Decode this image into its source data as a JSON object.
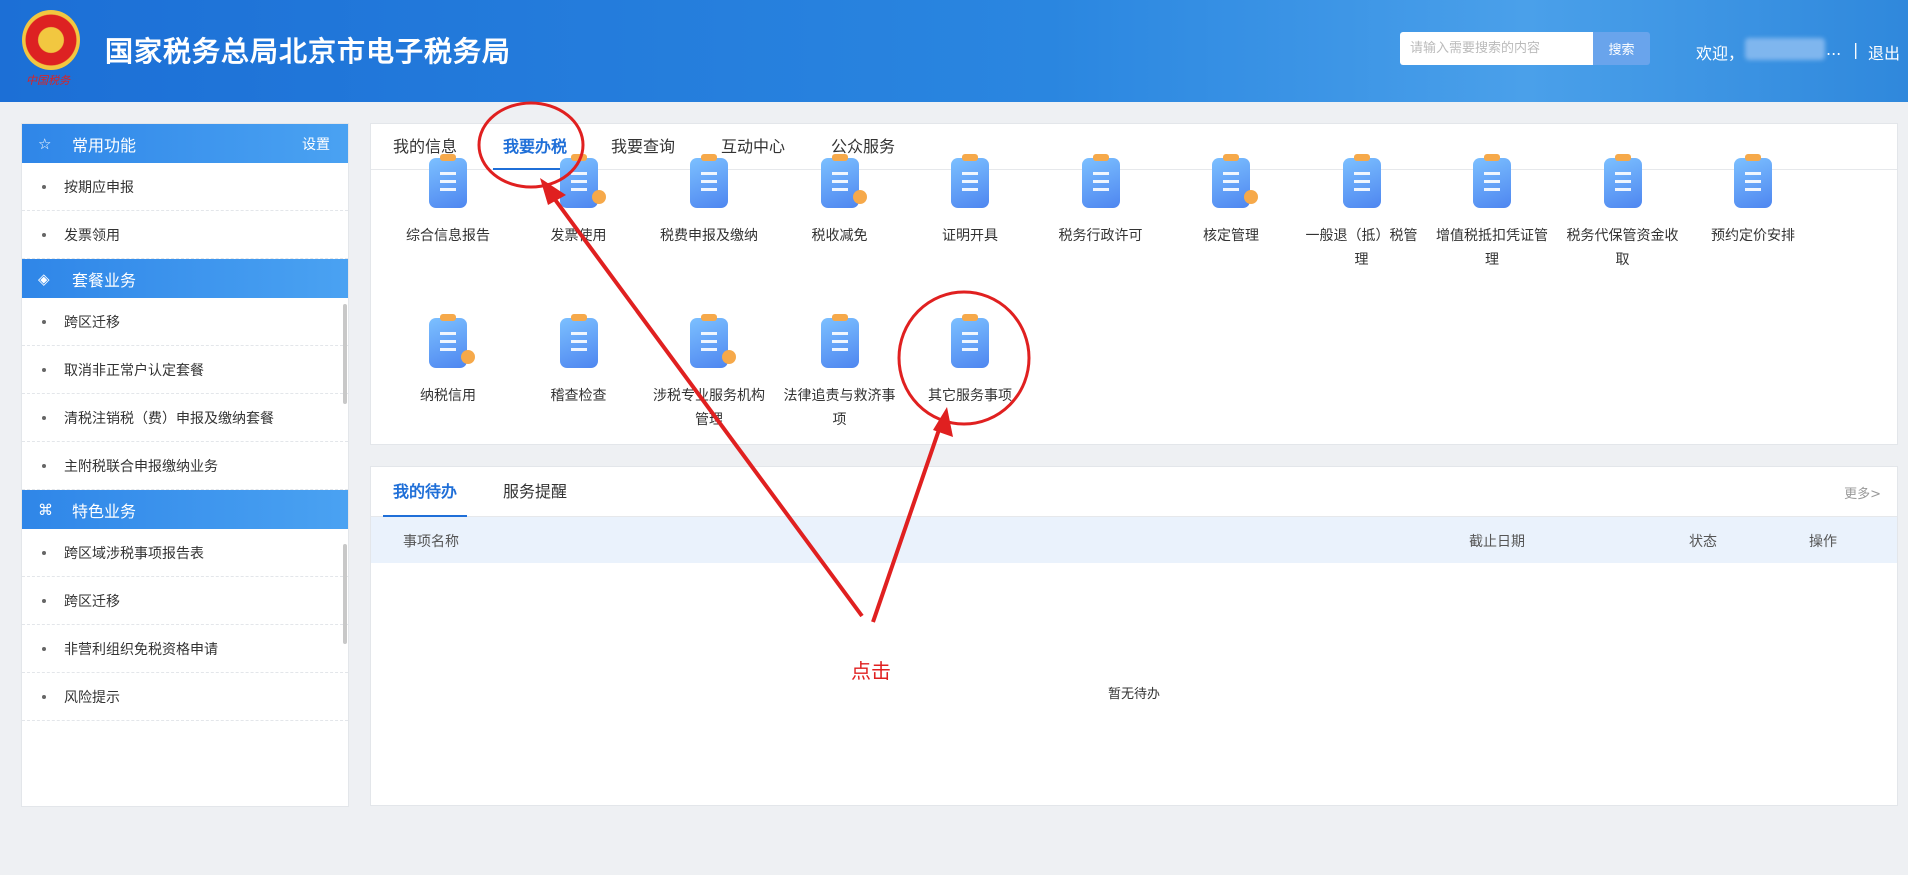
{
  "header": {
    "title": "国家税务总局北京市电子税务局",
    "emblem_text": "中国税务",
    "search_placeholder": "请输入需要搜索的内容",
    "search_label": "搜索",
    "welcome": "欢迎，",
    "welcome_suffix": "...",
    "separator": "|",
    "logout": "退出"
  },
  "sidebar": {
    "sections": [
      {
        "title": "常用功能",
        "icon": "star-icon",
        "action": "设置",
        "items": [
          "按期应申报",
          "发票领用"
        ]
      },
      {
        "title": "套餐业务",
        "icon": "layers-icon",
        "items": [
          "跨区迁移",
          "取消非正常户认定套餐",
          "清税注销税（费）申报及缴纳套餐",
          "主附税联合申报缴纳业务"
        ]
      },
      {
        "title": "特色业务",
        "icon": "grid-icon",
        "items": [
          "跨区域涉税事项报告表",
          "跨区迁移",
          "非营利组织免税资格申请",
          "风险提示"
        ]
      }
    ]
  },
  "main_tabs": [
    "我的信息",
    "我要办税",
    "我要查询",
    "互动中心",
    "公众服务"
  ],
  "services": [
    {
      "label": "综合信息报告",
      "icon": "clipboard-icon"
    },
    {
      "label": "发票使用",
      "icon": "invoice-check-icon"
    },
    {
      "label": "税费申报及缴纳",
      "icon": "wallet-yuan-icon"
    },
    {
      "label": "税收减免",
      "icon": "tax-coin-icon"
    },
    {
      "label": "证明开具",
      "icon": "ticket-yuan-icon"
    },
    {
      "label": "税务行政许可",
      "icon": "id-card-icon"
    },
    {
      "label": "核定管理",
      "icon": "user-gear-icon"
    },
    {
      "label": "一般退（抵）税管理",
      "icon": "refund-yuan-icon"
    },
    {
      "label": "增值税抵扣凭证管理",
      "icon": "vat-voucher-icon"
    },
    {
      "label": "税务代保管资金收取",
      "icon": "money-bag-hand-icon"
    },
    {
      "label": "预约定价安排",
      "icon": "compass-icon"
    },
    {
      "label": "纳税信用",
      "icon": "diamond-check-icon"
    },
    {
      "label": "稽查检查",
      "icon": "stamp-icon"
    },
    {
      "label": "涉税专业服务机构管理",
      "icon": "agent-gear-icon"
    },
    {
      "label": "法律追责与救济事项",
      "icon": "gavel-icon"
    },
    {
      "label": "其它服务事项",
      "icon": "clipboard-icon"
    }
  ],
  "todo": {
    "tabs": [
      "我的待办",
      "服务提醒"
    ],
    "more": "更多>",
    "columns": [
      "事项名称",
      "截止日期",
      "状态",
      "操作"
    ],
    "empty": "暂无待办"
  },
  "annotation": {
    "text": "点击",
    "color": "#e02020"
  }
}
